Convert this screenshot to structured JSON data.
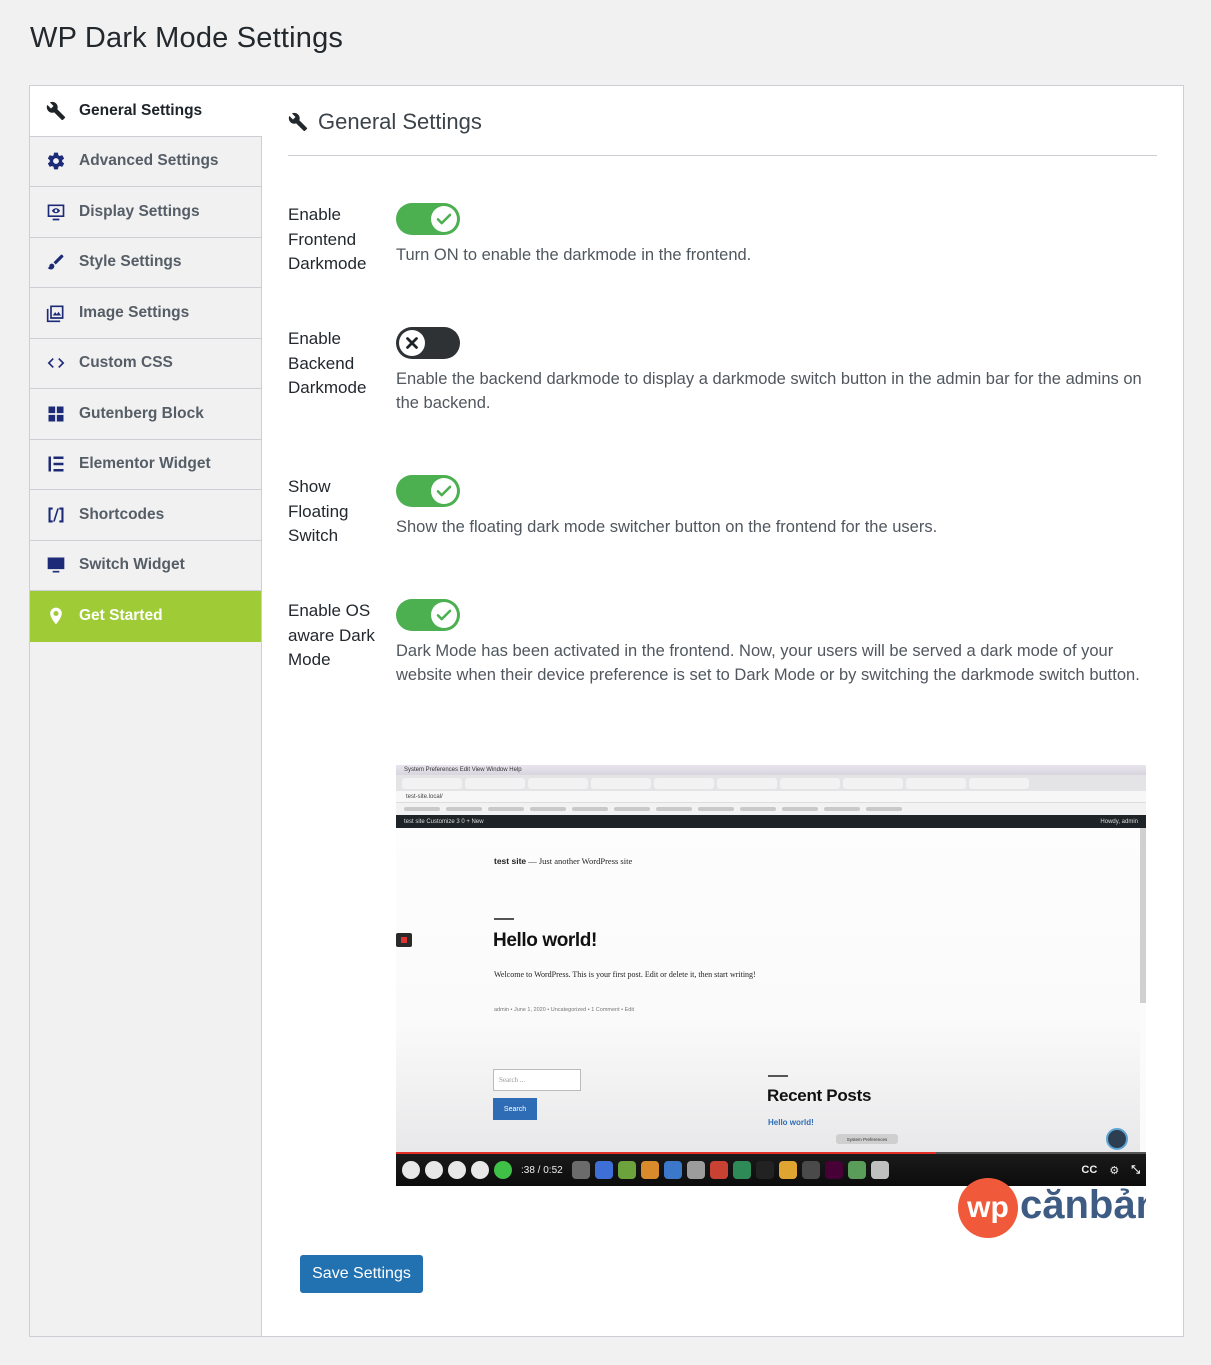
{
  "page": {
    "title": "WP Dark Mode Settings"
  },
  "sidebar": {
    "items": [
      {
        "label": "General Settings",
        "icon": "wrench-icon"
      },
      {
        "label": "Advanced Settings",
        "icon": "gear-icon"
      },
      {
        "label": "Display Settings",
        "icon": "monitor-eye-icon"
      },
      {
        "label": "Style Settings",
        "icon": "paintbrush-icon"
      },
      {
        "label": "Image Settings",
        "icon": "images-icon"
      },
      {
        "label": "Custom CSS",
        "icon": "code-icon"
      },
      {
        "label": "Gutenberg Block",
        "icon": "blocks-icon"
      },
      {
        "label": "Elementor Widget",
        "icon": "elementor-icon"
      },
      {
        "label": "Shortcodes",
        "icon": "shortcode-icon"
      },
      {
        "label": "Switch Widget",
        "icon": "desktop-icon"
      },
      {
        "label": "Get Started",
        "icon": "location-pin-icon"
      }
    ],
    "active_index": 0,
    "get_started_color": "#9ecb36"
  },
  "section": {
    "title": "General Settings"
  },
  "settings": [
    {
      "label": "Enable Frontend Darkmode",
      "enabled": true,
      "description": "Turn ON to enable the darkmode in the frontend."
    },
    {
      "label": "Enable Backend Darkmode",
      "enabled": false,
      "description": "Enable the backend darkmode to display a darkmode switch button in the admin bar for the admins on the backend."
    },
    {
      "label": "Show Floating Switch",
      "enabled": true,
      "description": "Show the floating dark mode switcher button on the frontend for the users."
    },
    {
      "label": "Enable OS aware Dark Mode",
      "enabled": true,
      "description": "Dark Mode has been activated in the frontend. Now, your users will be served a dark mode of your website when their device preference is set to Dark Mode or by switching the darkmode switch button."
    }
  ],
  "video": {
    "site_name": "test site",
    "site_tagline": "— Just another WordPress site",
    "post_title": "Hello world!",
    "post_excerpt": "Welcome to WordPress. This is your first post. Edit or delete it, then start writing!",
    "post_meta": "admin   •  June 1, 2020   •  Uncategorized   •  1 Comment   •  Edit",
    "search_placeholder": "Search ...",
    "search_button": "Search",
    "recent_posts_title": "Recent Posts",
    "recent_post_link": "Hello world!",
    "tooltip": "System Preferences",
    "time": ":38 / 0:52",
    "url": "test-site.local/",
    "admin_bar_left": "test site    Customize    3    0    + New",
    "admin_bar_right": "Howdy, admin",
    "menubar": "System Preferences   Edit   View   Window   Help"
  },
  "watermark": {
    "text_wp": "wp",
    "text_rest": "cănbản"
  },
  "actions": {
    "save_label": "Save Settings"
  },
  "colors": {
    "toggle_on": "#4caf50",
    "toggle_off": "#2f3235",
    "primary": "#2271b1"
  }
}
